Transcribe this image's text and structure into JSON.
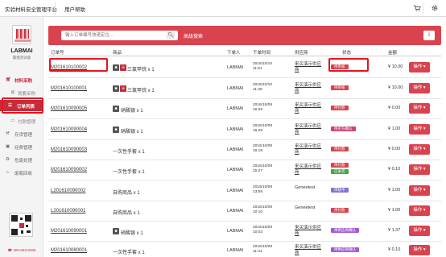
{
  "topbar": {
    "system_title": "实验材料安全管理平台",
    "help": "用户帮助",
    "cart_icon": "cart-icon",
    "settings_icon": "gear-icon"
  },
  "sidebar": {
    "brand_name": "LABMAI",
    "brand_sub": "赢捷测试版",
    "items": [
      {
        "label": "材料采购",
        "icon": "cart-icon"
      },
      {
        "label": "我要采购",
        "icon": "cart-icon"
      },
      {
        "label": "订单列表",
        "icon": "list-icon"
      },
      {
        "label": "付款管理",
        "icon": "card-icon"
      },
      {
        "label": "存货管理",
        "icon": "box-icon"
      },
      {
        "label": "经费管理",
        "icon": "wallet-icon"
      },
      {
        "label": "危废处理",
        "icon": "recycle-icon"
      },
      {
        "label": "废瓶回收",
        "icon": "bottle-icon"
      }
    ],
    "phone": "400-843-6255"
  },
  "search": {
    "placeholder": "输入订单编号快速定位...",
    "advanced": "高级搜索",
    "search_icon": "search-icon",
    "export_icon": "download-icon"
  },
  "table": {
    "headers": [
      "订单号",
      "商品",
      "下单人",
      "下单时间",
      "供应商",
      "状态",
      "金额"
    ],
    "rows": [
      {
        "order_no": "M201610100002",
        "goods": "三氯甲烷  x 1",
        "orderer": "LABMAI",
        "date": "2016/10/10",
        "time": "11:51",
        "supplier1": "来买演示供应",
        "supplier2": "商",
        "statuses": [
          {
            "text": "待审核",
            "color": "red"
          }
        ],
        "amount": "¥ 10.00",
        "op": "操作"
      },
      {
        "order_no": "M201610100001",
        "goods": "三氯甲烷  x 1",
        "orderer": "LABMAI",
        "date": "2016/10/10",
        "time": "11:48",
        "supplier1": "来买演示供应",
        "supplier2": "商",
        "statuses": [
          {
            "text": "待审核",
            "color": "red"
          }
        ],
        "amount": "¥ 10.00",
        "op": "操作"
      },
      {
        "order_no": "M201610090005",
        "goods": "硝酸银  x 1",
        "orderer": "LABMAI",
        "date": "2016/10/09",
        "time": "16:29",
        "supplier1": "来买演示供应",
        "supplier2": "商",
        "statuses": [
          {
            "text": "待付款",
            "color": "red"
          }
        ],
        "amount": "¥ 0.00",
        "op": "操作"
      },
      {
        "order_no": "M201610090004",
        "goods": "硝酸银  x 1",
        "orderer": "LABMAI",
        "date": "2016/10/09",
        "time": "16:25",
        "supplier1": "来买演示供应",
        "supplier2": "商",
        "statuses": [
          {
            "text": "待买方确认",
            "color": "pink"
          }
        ],
        "amount": "¥ 1.00",
        "op": "操作"
      },
      {
        "order_no": "M201610090003",
        "goods": "一次性手套  x 1",
        "orderer": "LABMAI",
        "date": "2016/10/09",
        "time": "16:18",
        "supplier1": "来买演示供应",
        "supplier2": "商",
        "statuses": [
          {
            "text": "待付款",
            "color": "red"
          }
        ],
        "amount": "¥ 0.00",
        "op": "操作"
      },
      {
        "order_no": "M201610090002",
        "goods": "一次性手套  x 1",
        "orderer": "LABMAI",
        "date": "2016/10/09",
        "time": "15:27",
        "supplier1": "来买演示供应",
        "supplier2": "商",
        "statuses": [
          {
            "text": "待付款",
            "color": "red"
          },
          {
            "text": "已发货",
            "color": "green"
          }
        ],
        "amount": "¥ 0.10",
        "op": "操作"
      },
      {
        "order_no": "L201610090002",
        "goods": "自购商品  x 1",
        "orderer": "LABMAI",
        "date": "2016/10/09",
        "time": "13:59",
        "supplier1": "Geneetest",
        "supplier2": "",
        "statuses": [
          {
            "text": "审核中",
            "color": "blue"
          }
        ],
        "amount": "¥ 1.00",
        "op": "操作"
      },
      {
        "order_no": "L201610090001",
        "goods": "自购商品  x 1",
        "orderer": "LABMAI",
        "date": "2016/10/09",
        "time": "10:10",
        "supplier1": "Geneetest",
        "supplier2": "",
        "statuses": [
          {
            "text": "待付款",
            "color": "red"
          }
        ],
        "amount": "¥ 1.00",
        "op": "操作"
      },
      {
        "order_no": "M201610090001",
        "goods": "硝酸银  x 1",
        "orderer": "LABMAI",
        "date": "2016/10/09",
        "time": "10:03",
        "supplier1": "来买演示供应",
        "supplier2": "商",
        "statuses": [
          {
            "text": "待供应商确认",
            "color": "purple"
          }
        ],
        "amount": "¥ 1.37",
        "op": "操作"
      },
      {
        "order_no": "M201610080001",
        "goods": "一次性手套  x 1",
        "orderer": "LABMAI",
        "date": "2016/10/08",
        "time": "11:31",
        "supplier1": "来买演示供应",
        "supplier2": "商",
        "statuses": [
          {
            "text": "待供应商确认",
            "color": "purple"
          }
        ],
        "amount": "¥ 0.10",
        "op": "操作"
      }
    ]
  }
}
